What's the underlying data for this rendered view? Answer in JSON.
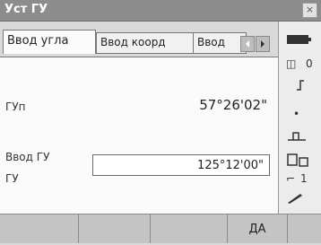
{
  "window": {
    "title": "Уст ГУ",
    "close_glyph": "×"
  },
  "tabs": [
    {
      "label": "Ввод угла",
      "active": true
    },
    {
      "label": "Ввод коорд",
      "active": false
    },
    {
      "label": "Ввод",
      "active": false
    }
  ],
  "form": {
    "gu_label": "ГУп",
    "gu_value": "57°26'02\"",
    "input_section_label": "Ввод ГУ",
    "input_label": "ГУ",
    "input_value": "125°12'00\""
  },
  "sidebar": {
    "items": [
      {
        "icon": "battery-icon"
      },
      {
        "text": "0",
        "icon": "prism-icon"
      },
      {
        "icon": "target-icon"
      },
      {
        "icon": "dot-icon"
      },
      {
        "icon": "level-icon"
      },
      {
        "icon": "instrument-icon"
      },
      {
        "text": "1",
        "icon": "face-icon"
      },
      {
        "icon": "pen-icon"
      }
    ]
  },
  "softkeys": [
    "",
    "",
    "",
    "",
    "ДА"
  ],
  "colors": {
    "titlebar": "#8c8c8c",
    "panel": "#fafafa",
    "softkey_bar": "#c4c4c4"
  }
}
